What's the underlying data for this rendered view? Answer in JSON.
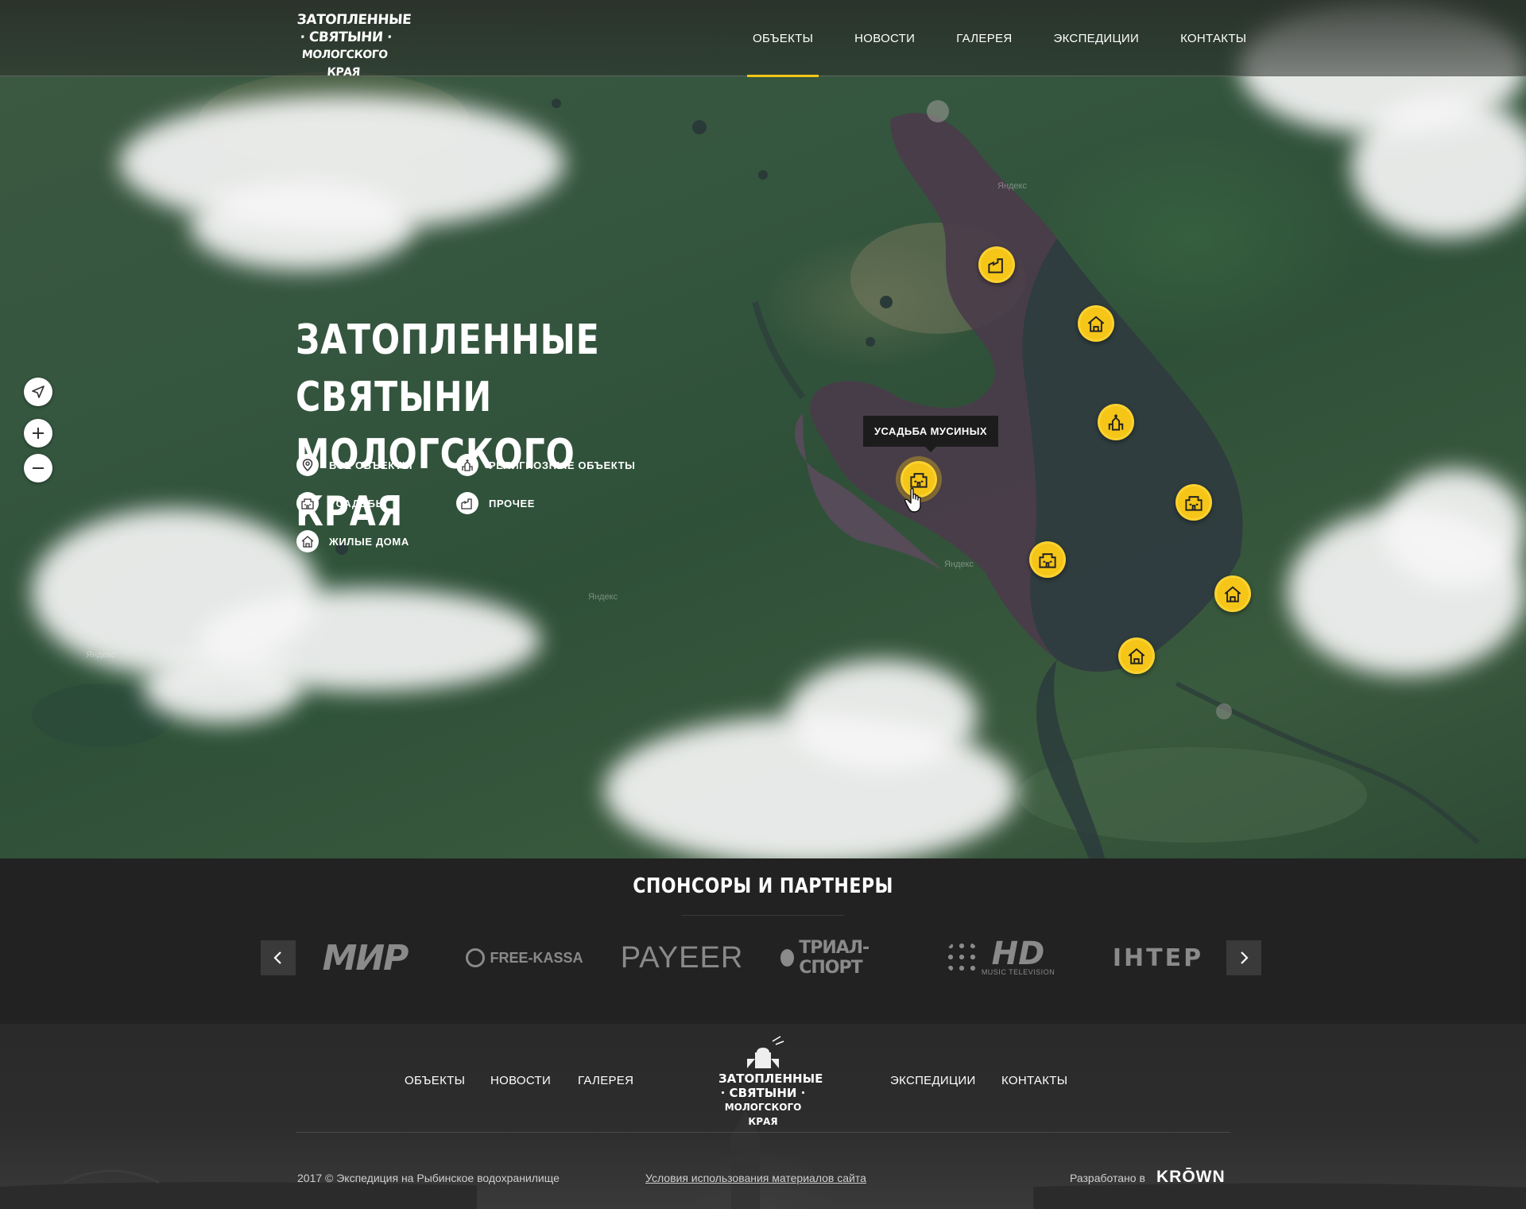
{
  "header": {
    "logo_lines": [
      "ЗАТОПЛЕННЫЕ",
      "· СВЯТЫНИ ·",
      "МОЛОГСКОГО КРАЯ"
    ],
    "nav": [
      {
        "label": "ОБЪЕКТЫ",
        "active": true
      },
      {
        "label": "НОВОСТИ",
        "active": false
      },
      {
        "label": "ГАЛЕРЕЯ",
        "active": false
      },
      {
        "label": "ЭКСПЕДИЦИИ",
        "active": false
      },
      {
        "label": "КОНТАКТЫ",
        "active": false
      }
    ]
  },
  "hero": {
    "title_line1": "ЗАТОПЛЕННЫЕ СВЯТЫНИ",
    "title_line2": "МОЛОГСКОГО КРАЯ",
    "filters": [
      {
        "label": "ВСЕ ОБЪЕКТЫ",
        "icon": "map-pin-icon"
      },
      {
        "label": "РЕЛИГИОЗНЫЕ ОБЪЕКТЫ",
        "icon": "church-icon"
      },
      {
        "label": "УСАДЬБЫ",
        "icon": "manor-icon"
      },
      {
        "label": "ПРОЧЕЕ",
        "icon": "factory-icon"
      },
      {
        "label": "ЖИЛЫЕ ДОМА",
        "icon": "house-icon"
      }
    ]
  },
  "map": {
    "tooltip": "УСАДЬБА МУСИНЫХ",
    "watermark": "Яндекс",
    "markers": [
      {
        "type": "factory-icon"
      },
      {
        "type": "house-icon"
      },
      {
        "type": "church-icon"
      },
      {
        "type": "manor-icon",
        "active": true
      },
      {
        "type": "manor-icon"
      },
      {
        "type": "manor-icon"
      },
      {
        "type": "house-icon"
      },
      {
        "type": "house-icon"
      }
    ],
    "controls": [
      "locate-icon",
      "zoom-in-icon",
      "zoom-out-icon"
    ],
    "accent_color": "#f5c518"
  },
  "sponsors": {
    "title": "СПОНСОРЫ И ПАРТНЕРЫ",
    "partners": [
      "МИР",
      "FREE-KASSA",
      "PAYEER",
      "ТРИАЛ-СПОРТ",
      "HD",
      "ІНТЕР"
    ],
    "partner_sublines": {
      "hd": "MUSIC TELEVISION"
    }
  },
  "footer": {
    "nav_left": [
      "ОБЪЕКТЫ",
      "НОВОСТИ",
      "ГАЛЕРЕЯ"
    ],
    "nav_right": [
      "ЭКСПЕДИЦИИ",
      "КОНТАКТЫ"
    ],
    "logo_lines": [
      "ЗАТОПЛЕННЫЕ",
      "· СВЯТЫНИ ·",
      "МОЛОГСКОГО КРАЯ"
    ],
    "copyright": "2017 © Экспедиция на Рыбинское водохранилище",
    "terms": "Условия использования материалов сайта",
    "dev_label": "Разработано в",
    "dev_brand": "KRŌWN"
  }
}
